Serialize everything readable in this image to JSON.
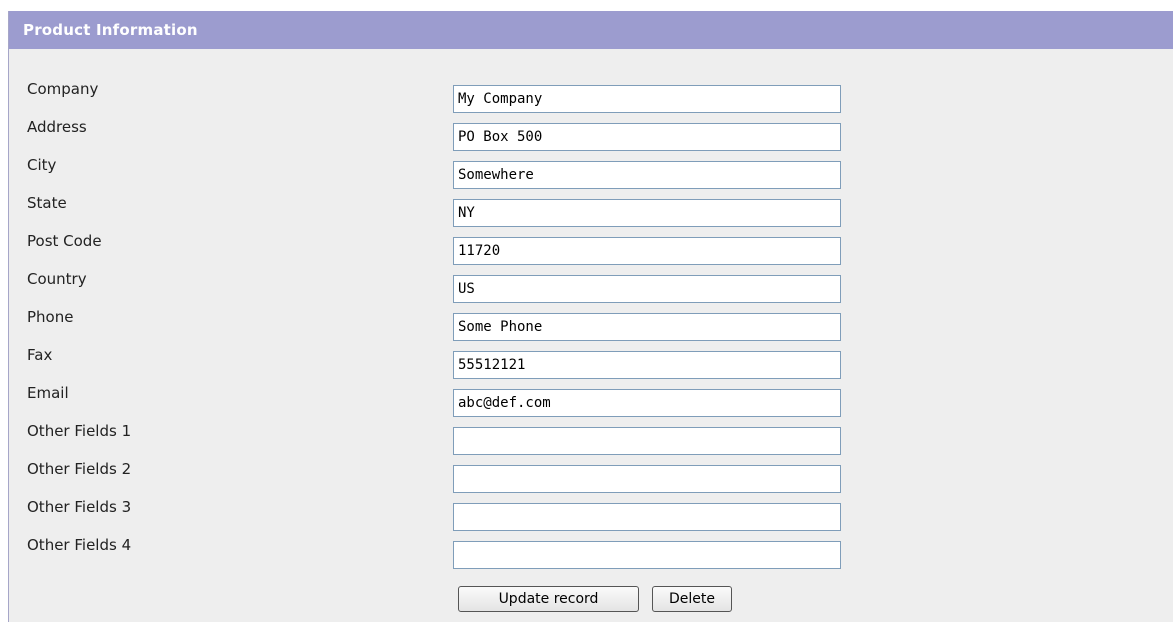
{
  "panel": {
    "title": "Product Information"
  },
  "fields": [
    {
      "label": "Company",
      "value": "My Company"
    },
    {
      "label": "Address",
      "value": "PO Box 500"
    },
    {
      "label": "City",
      "value": "Somewhere"
    },
    {
      "label": "State",
      "value": "NY"
    },
    {
      "label": "Post Code",
      "value": "11720"
    },
    {
      "label": "Country",
      "value": "US"
    },
    {
      "label": "Phone",
      "value": "Some Phone"
    },
    {
      "label": "Fax",
      "value": "55512121"
    },
    {
      "label": "Email",
      "value": "abc@def.com"
    },
    {
      "label": "Other Fields 1",
      "value": ""
    },
    {
      "label": "Other Fields 2",
      "value": ""
    },
    {
      "label": "Other Fields 3",
      "value": ""
    },
    {
      "label": "Other Fields 4",
      "value": ""
    }
  ],
  "actions": {
    "update_label": "Update record",
    "delete_label": "Delete"
  },
  "colors": {
    "header_bg": "#9c9ccf",
    "panel_bg": "#eeeeee",
    "input_border": "#7f9db9"
  }
}
